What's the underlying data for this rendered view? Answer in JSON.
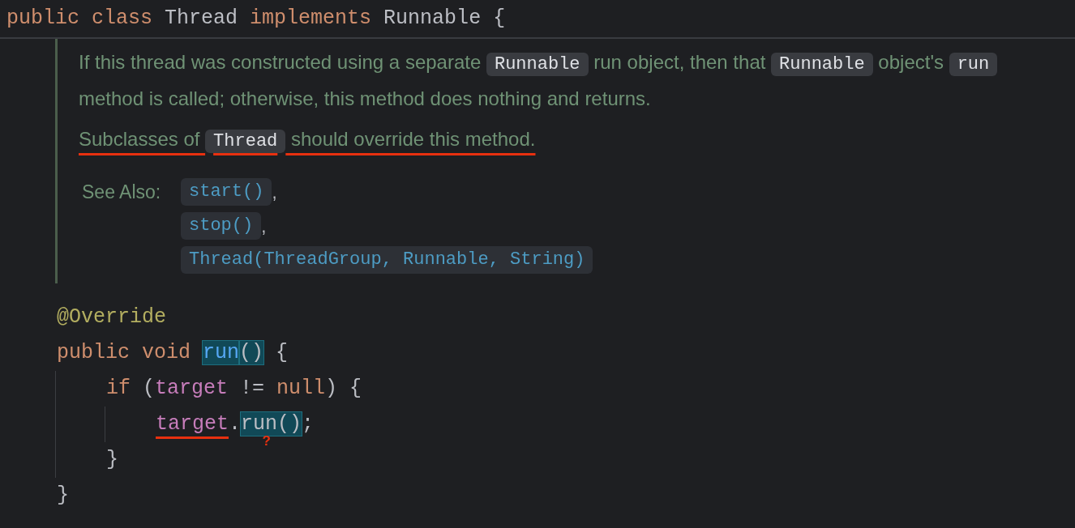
{
  "class_line": {
    "tokens": [
      {
        "kind": "keyword",
        "text": "public class "
      },
      {
        "kind": "plain",
        "text": "Thread "
      },
      {
        "kind": "keyword",
        "text": "implements "
      },
      {
        "kind": "plain",
        "text": "Runnable {"
      }
    ]
  },
  "doc": {
    "paragraphs": [
      {
        "underlined": false,
        "segments": [
          {
            "kind": "text",
            "text": "If this thread was constructed using a separate "
          },
          {
            "kind": "code",
            "text": "Runnable"
          },
          {
            "kind": "text",
            "text": " run object, then that "
          },
          {
            "kind": "code",
            "text": "Runnable"
          },
          {
            "kind": "text",
            "text": " object's "
          },
          {
            "kind": "code",
            "text": "run"
          },
          {
            "kind": "text",
            "text": " method is called; otherwise, this method does nothing and returns."
          }
        ]
      },
      {
        "underlined": true,
        "segments": [
          {
            "kind": "text",
            "text": "Subclasses of "
          },
          {
            "kind": "code",
            "text": "Thread"
          },
          {
            "kind": "text",
            "text": " should override this method."
          }
        ]
      }
    ],
    "see_also": {
      "label": "See Also:",
      "links": [
        {
          "text": "start()",
          "separator": ","
        },
        {
          "text": "stop()",
          "separator": ","
        },
        {
          "text": "Thread(ThreadGroup, Runnable, String)"
        }
      ]
    }
  },
  "code": [
    {
      "tokens": [
        {
          "kind": "annotation",
          "text": "@Override"
        }
      ]
    },
    {
      "tokens": [
        {
          "kind": "keyword",
          "text": "public void "
        },
        {
          "kind": "method",
          "text": "run",
          "highlighted": true
        },
        {
          "kind": "plain",
          "text": "()",
          "highlighted": true
        },
        {
          "kind": "plain",
          "text": " {"
        }
      ],
      "children": [
        {
          "tokens": [
            {
              "kind": "keyword",
              "text": "if "
            },
            {
              "kind": "plain",
              "text": "("
            },
            {
              "kind": "field",
              "text": "target"
            },
            {
              "kind": "plain",
              "text": " != "
            },
            {
              "kind": "keyword",
              "text": "null"
            },
            {
              "kind": "plain",
              "text": ") {"
            }
          ],
          "children": [
            {
              "tokens": [
                {
                  "kind": "field",
                  "text": "target",
                  "underlined": true
                },
                {
                  "kind": "plain",
                  "text": "."
                },
                {
                  "kind": "plain",
                  "text": "run()",
                  "highlighted": true
                },
                {
                  "kind": "plain",
                  "text": ";"
                },
                {
                  "kind": "mark",
                  "text": "?"
                }
              ]
            }
          ],
          "close": "}"
        }
      ],
      "close": "}"
    }
  ]
}
